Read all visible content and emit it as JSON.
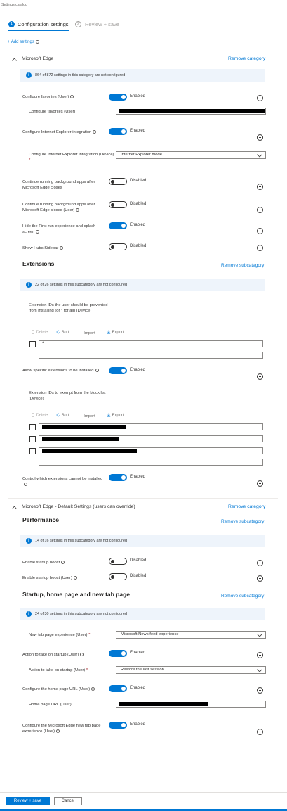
{
  "header": {
    "breadcrumb": "Settings catalog",
    "steps": [
      {
        "number": "1",
        "label": "Configuration settings"
      },
      {
        "number": "2",
        "label": "Review + save"
      }
    ],
    "add_settings": "+ Add settings"
  },
  "edge": {
    "title": "Microsoft Edge",
    "remove": "Remove category",
    "info": "864 of 872 settings in this category are not configured",
    "settings": {
      "fav": {
        "label": "Configure favorites (User)",
        "state": "Enabled",
        "sub_label": "Configure favorites (User)"
      },
      "ie": {
        "label": "Configure Internet Explorer integration",
        "state": "Enabled",
        "sub_label": "Configure Internet Explorer integration (Device)",
        "required": "*",
        "value": "Internet Explorer mode"
      },
      "bg1": {
        "label": "Continue running background apps after Microsoft Edge closes",
        "state": "Disabled"
      },
      "bg2": {
        "label": "Continue running background apps after Microsoft Edge closes (User)",
        "state": "Disabled"
      },
      "fre": {
        "label": "Hide the First-run experience and splash screen",
        "state": "Enabled"
      },
      "hubs": {
        "label": "Show Hubs Sidebar",
        "state": "Disabled"
      }
    },
    "extensions": {
      "title": "Extensions",
      "remove": "Remove subcategory",
      "info": "22 of 26 settings in this subcategory are not configured",
      "block_label": "Extension IDs the user should be prevented from installing (or * for all) (Device)",
      "block_value": "*",
      "toolbar": {
        "delete": "Delete",
        "sort": "Sort",
        "import": "Import",
        "export": "Export"
      },
      "allow_label": "Allow specific extensions to be installed",
      "allow_state": "Enabled",
      "exempt_label": "Extension IDs to exempt from the block list (Device)",
      "control_label": "Control which extensions cannot be installed",
      "control_state": "Enabled"
    }
  },
  "defaults": {
    "title": "Microsoft Edge - Default Settings (users can override)",
    "remove": "Remove category",
    "performance": {
      "title": "Performance",
      "remove": "Remove subcategory",
      "info": "14 of 16 settings in this subcategory are not configured",
      "boost1": {
        "label": "Enable startup boost",
        "state": "Disabled"
      },
      "boost2": {
        "label": "Enable startup boost (User)",
        "state": "Disabled"
      }
    },
    "startup": {
      "title": "Startup, home page and new tab page",
      "remove": "Remove subcategory",
      "info": "24 of 30 settings in this subcategory are not configured",
      "ntp_label": "New tab page experience (User)",
      "ntp_value": "Microsoft News feed experience",
      "action_label": "Action to take on startup (User)",
      "action_state": "Enabled",
      "action_sub_label": "Action to take on startup (User)",
      "action_value": "Restore the last session",
      "home_label": "Configure the home page URL (User)",
      "home_state": "Enabled",
      "home_sub_label": "Home page URL (User)",
      "newtab_label": "Configure the Microsoft Edge new tab page experience (User)",
      "newtab_state": "Enabled",
      "required": "*"
    }
  },
  "footer": {
    "review": "Review + save",
    "cancel": "Cancel"
  }
}
